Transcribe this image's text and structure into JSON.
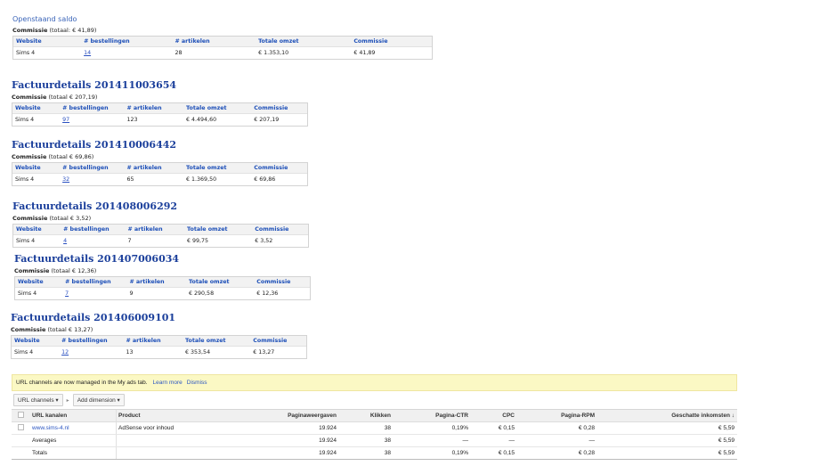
{
  "open_balance": {
    "title": "Openstaand saldo",
    "commission_label": "Commissie",
    "commission_total": "(totaal: € 41,89)",
    "headers": [
      "Website",
      "# bestellingen",
      "# artikelen",
      "Totale omzet",
      "Commissie"
    ],
    "row": [
      "Sims 4",
      "14",
      "28",
      "€ 1.353,10",
      "€ 41,89"
    ]
  },
  "invoices": [
    {
      "title": "Factuurdetails 201411003654",
      "commission_label": "Commissie",
      "commission_total": "(totaal € 207,19)",
      "headers": [
        "Website",
        "# bestellingen",
        "# artikelen",
        "Totale omzet",
        "Commissie"
      ],
      "row": [
        "Sims 4",
        "97",
        "123",
        "€ 4.494,60",
        "€ 207,19"
      ]
    },
    {
      "title": "Factuurdetails 201410006442",
      "commission_label": "Commissie",
      "commission_total": "(totaal € 69,86)",
      "headers": [
        "Website",
        "# bestellingen",
        "# artikelen",
        "Totale omzet",
        "Commissie"
      ],
      "row": [
        "Sims 4",
        "32",
        "65",
        "€ 1.369,50",
        "€ 69,86"
      ]
    },
    {
      "title": "Factuurdetails 201408006292",
      "commission_label": "Commissie",
      "commission_total": "(totaal € 3,52)",
      "headers": [
        "Website",
        "# bestellingen",
        "# artikelen",
        "Totale omzet",
        "Commissie"
      ],
      "row": [
        "Sims 4",
        "4",
        "7",
        "€ 99,75",
        "€ 3,52"
      ]
    },
    {
      "title": "Factuurdetails 201407006034",
      "commission_label": "Commissie",
      "commission_total": "(totaal € 12,36)",
      "headers": [
        "Website",
        "# bestellingen",
        "# artikelen",
        "Totale omzet",
        "Commissie"
      ],
      "row": [
        "Sims 4",
        "7",
        "9",
        "€ 290,58",
        "€ 12,36"
      ]
    },
    {
      "title": "Factuurdetails 201406009101",
      "commission_label": "Commissie",
      "commission_total": "(totaal € 13,27)",
      "headers": [
        "Website",
        "# bestellingen",
        "# artikelen",
        "Totale omzet",
        "Commissie"
      ],
      "row": [
        "Sims 4",
        "12",
        "13",
        "€ 353,54",
        "€ 13,27"
      ]
    }
  ],
  "adsense": {
    "notice": "URL channels are now managed in the My ads tab.",
    "learn_more": "Learn more",
    "dismiss": "Dismiss",
    "url_channels_btn": "URL channels",
    "add_dimension_btn": "Add dimension",
    "headers": [
      "URL kanalen",
      "Product",
      "Paginaweergaven",
      "Klikken",
      "Pagina-CTR",
      "CPC",
      "Pagina-RPM",
      "Geschatte inkomsten ↓"
    ],
    "rows": [
      [
        "www.sims-4.nl",
        "AdSense voor inhoud",
        "19.924",
        "38",
        "0,19%",
        "€ 0,15",
        "€ 0,28",
        "€ 5,59"
      ],
      [
        "Averages",
        "",
        "19.924",
        "38",
        "—",
        "—",
        "—",
        "€ 5,59"
      ],
      [
        "Totals",
        "",
        "19.924",
        "38",
        "0,19%",
        "€ 0,15",
        "€ 0,28",
        "€ 5,59"
      ]
    ]
  }
}
